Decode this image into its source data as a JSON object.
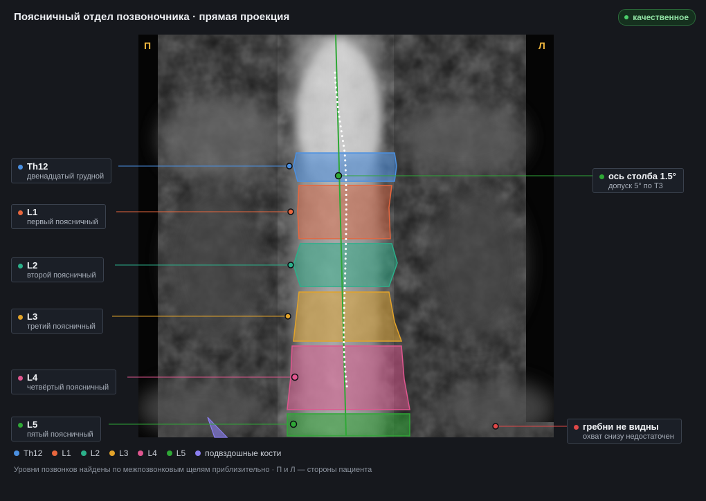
{
  "header": {
    "title": "Поясничный отдел позвоночника · прямая проекция",
    "badge": "качественное",
    "badge_color": "#4ccf6b"
  },
  "image": {
    "left_marker": "П",
    "right_marker": "Л"
  },
  "vertebrae": [
    {
      "id": "Th12",
      "name": "Th12",
      "desc": "двенадцатый грудной",
      "color": "#4a90e2"
    },
    {
      "id": "L1",
      "name": "L1",
      "desc": "первый поясничный",
      "color": "#e8663d"
    },
    {
      "id": "L2",
      "name": "L2",
      "desc": "второй поясничный",
      "color": "#2bb08a"
    },
    {
      "id": "L3",
      "name": "L3",
      "desc": "третий поясничный",
      "color": "#e2a32a"
    },
    {
      "id": "L4",
      "name": "L4",
      "desc": "четвёртый поясничный",
      "color": "#e0568f"
    },
    {
      "id": "L5",
      "name": "L5",
      "desc": "пятый поясничный",
      "color": "#2fa836"
    }
  ],
  "axis": {
    "name": "ось столба 1.5°",
    "desc": "допуск 5° по Т3",
    "color": "#2fa836"
  },
  "crests": {
    "name": "гребни не видны",
    "desc": "охват снизу недостаточен",
    "color": "#e04848"
  },
  "legend": [
    {
      "label": "Th12",
      "color": "#4a90e2"
    },
    {
      "label": "L1",
      "color": "#e8663d"
    },
    {
      "label": "L2",
      "color": "#2bb08a"
    },
    {
      "label": "L3",
      "color": "#e2a32a"
    },
    {
      "label": "L4",
      "color": "#e0568f"
    },
    {
      "label": "L5",
      "color": "#2fa836"
    },
    {
      "label": "подвздошные кости",
      "color": "#8a7ef0"
    }
  ],
  "footnote": "Уровни позвонков найдены по межпозвонковым щелям приблизительно · П и Л — стороны пациента"
}
